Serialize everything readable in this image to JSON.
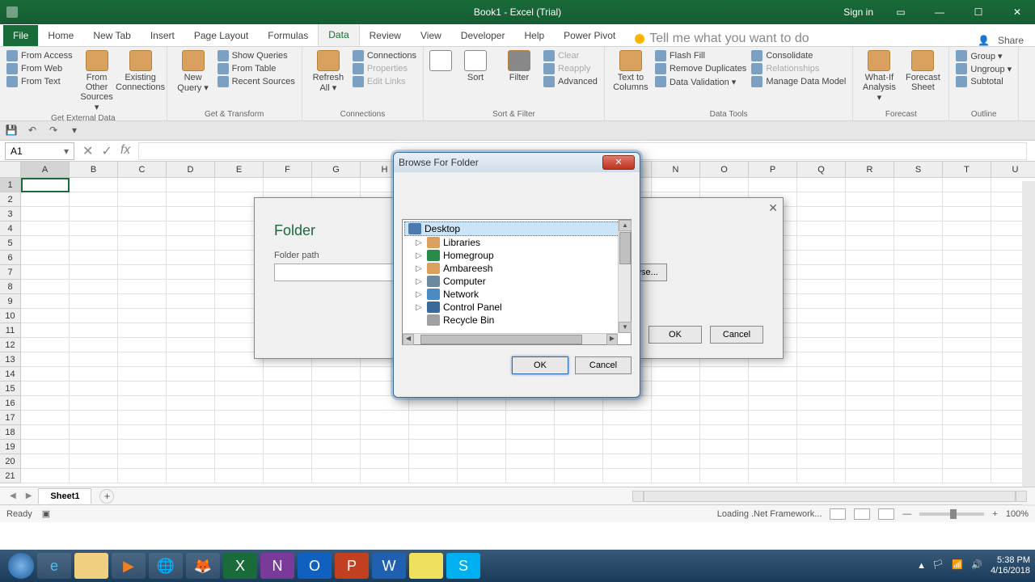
{
  "titlebar": {
    "title": "Book1 - Excel (Trial)",
    "signin": "Sign in"
  },
  "tabs": {
    "file": "File",
    "home": "Home",
    "newtab": "New Tab",
    "insert": "Insert",
    "pagelayout": "Page Layout",
    "formulas": "Formulas",
    "data": "Data",
    "review": "Review",
    "view": "View",
    "developer": "Developer",
    "help": "Help",
    "powerpivot": "Power Pivot",
    "tellme": "Tell me what you want to do",
    "share": "Share"
  },
  "ribbon": {
    "from_access": "From Access",
    "from_web": "From Web",
    "from_text": "From Text",
    "from_other": "From Other Sources ▾",
    "existing": "Existing Connections",
    "grp_ext": "Get External Data",
    "new_query": "New Query ▾",
    "show_queries": "Show Queries",
    "from_table": "From Table",
    "recent": "Recent Sources",
    "grp_trans": "Get & Transform",
    "refresh": "Refresh All ▾",
    "connections": "Connections",
    "properties": "Properties",
    "edit_links": "Edit Links",
    "grp_conn": "Connections",
    "sort": "Sort",
    "filter": "Filter",
    "clear": "Clear",
    "reapply": "Reapply",
    "advanced": "Advanced",
    "grp_sort": "Sort & Filter",
    "ttc": "Text to Columns",
    "flash": "Flash Fill",
    "dupes": "Remove Duplicates",
    "valid": "Data Validation ▾",
    "consol": "Consolidate",
    "relation": "Relationships",
    "model": "Manage Data Model",
    "grp_tools": "Data Tools",
    "whatif": "What-If Analysis ▾",
    "forecast": "Forecast Sheet",
    "grp_forecast": "Forecast",
    "group": "Group ▾",
    "ungroup": "Ungroup ▾",
    "subtotal": "Subtotal",
    "grp_outline": "Outline"
  },
  "namebox": "A1",
  "columns": [
    "A",
    "B",
    "C",
    "D",
    "E",
    "F",
    "G",
    "H",
    "N",
    "O",
    "P",
    "Q",
    "R",
    "S",
    "T",
    "U"
  ],
  "sheet": {
    "name": "Sheet1"
  },
  "status": {
    "ready": "Ready",
    "loading": "Loading .Net Framework...",
    "zoom": "100%"
  },
  "folder_dialog": {
    "title": "Folder",
    "label": "Folder path",
    "browse": "Browse...",
    "ok": "OK",
    "cancel": "Cancel"
  },
  "browse_dialog": {
    "title": "Browse For Folder",
    "ok": "OK",
    "cancel": "Cancel",
    "items": {
      "desktop": "Desktop",
      "libraries": "Libraries",
      "homegroup": "Homegroup",
      "user": "Ambareesh",
      "computer": "Computer",
      "network": "Network",
      "cp": "Control Panel",
      "bin": "Recycle Bin"
    }
  },
  "clock": {
    "time": "5:38 PM",
    "date": "4/16/2018"
  }
}
